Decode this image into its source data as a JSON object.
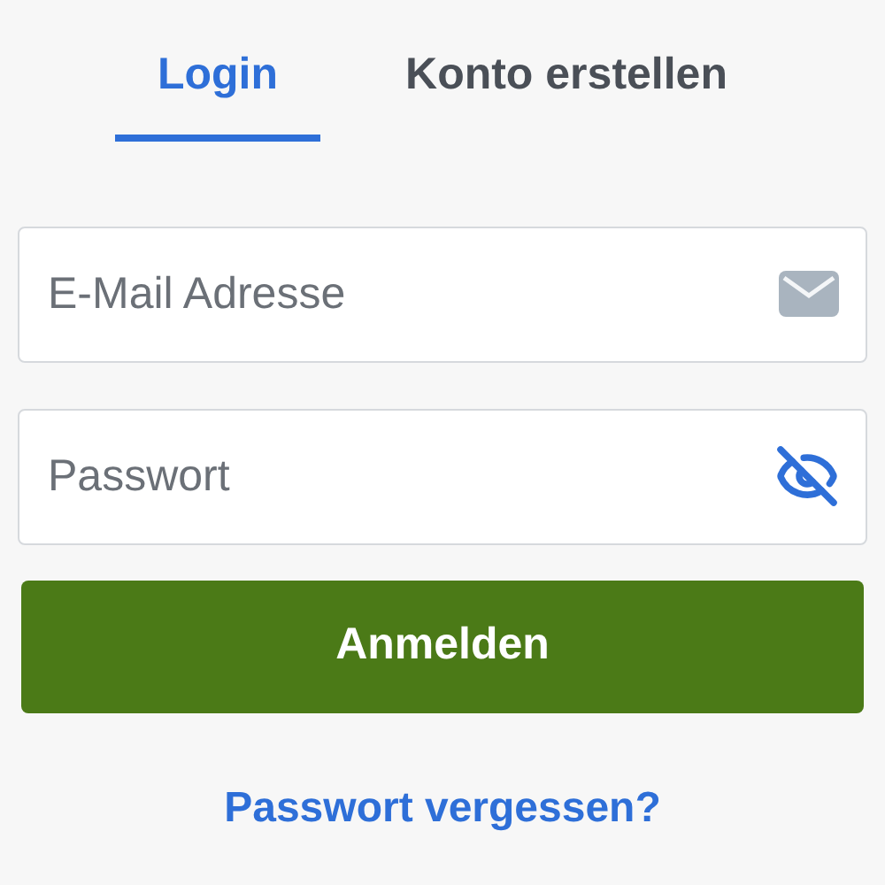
{
  "tabs": [
    {
      "label": "Login",
      "selected": true
    },
    {
      "label": "Konto erstellen",
      "selected": false
    }
  ],
  "fields": [
    {
      "kind": "email",
      "placeholder": "E-Mail Adresse"
    },
    {
      "kind": "password",
      "placeholder": "Passwort"
    }
  ],
  "submit": "Anmelden",
  "forgot_link": "Passwort vergessen?"
}
